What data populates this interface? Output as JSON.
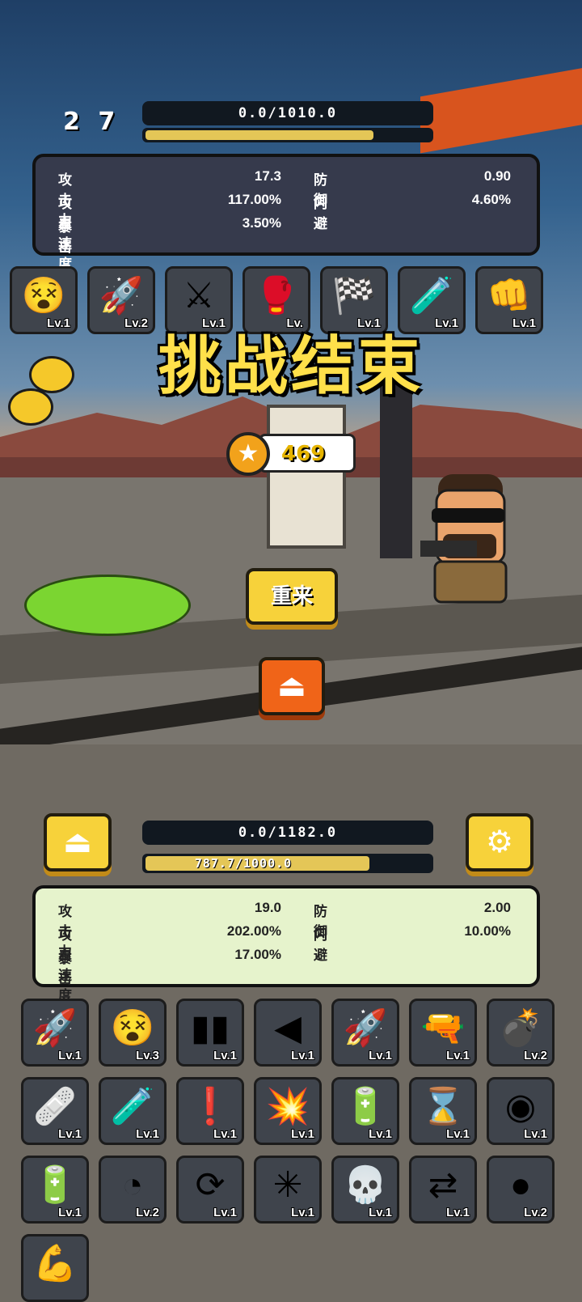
{
  "enemy": {
    "level": "2 7",
    "hp_text": "0.0/1010.0",
    "xp_progress": 0.8,
    "stats": {
      "atk_label": "攻击力",
      "atk_value": "17.3",
      "def_label": "防御",
      "def_value": "0.90",
      "aspd_label": "攻击速度",
      "aspd_value": "117.00%",
      "dodge_label": "闪避",
      "dodge_value": "4.60%",
      "crit_label": "暴击",
      "crit_value": "3.50%"
    },
    "skills": [
      {
        "icon": "dizzy-face-icon",
        "glyph": "😵",
        "level": "Lv.1"
      },
      {
        "icon": "rocket-icon",
        "glyph": "🚀",
        "level": "Lv.2"
      },
      {
        "icon": "crossed-swords-icon",
        "glyph": "⚔",
        "level": "Lv.1"
      },
      {
        "icon": "boxing-gloves-icon",
        "glyph": "🥊",
        "level": "Lv."
      },
      {
        "icon": "checkered-flag-icon",
        "glyph": "🏁",
        "level": "Lv.1"
      },
      {
        "icon": "potion-icon",
        "glyph": "🧪",
        "level": "Lv.1"
      },
      {
        "icon": "fist-icon",
        "glyph": "👊",
        "level": "Lv.1"
      }
    ]
  },
  "result": {
    "title": "挑战结束",
    "coins": "469",
    "retry_label": "重来"
  },
  "player": {
    "hp_text": "0.0/1182.0",
    "xp_text": "787.7/1000.0",
    "xp_progress": 0.7877,
    "stats": {
      "atk_label": "攻击力",
      "atk_value": "19.0",
      "def_label": "防御",
      "def_value": "2.00",
      "aspd_label": "攻击速度",
      "aspd_value": "202.00%",
      "dodge_label": "闪避",
      "dodge_value": "10.00%",
      "crit_label": "暴击",
      "crit_value": "17.00%"
    },
    "skills": [
      {
        "icon": "rocket-strike-icon",
        "glyph": "🚀",
        "level": "Lv.1"
      },
      {
        "icon": "dizzy-face-icon",
        "glyph": "😵",
        "level": "Lv.3"
      },
      {
        "icon": "bullets-icon",
        "glyph": "▮▮",
        "level": "Lv.1"
      },
      {
        "icon": "arrow-left-icon",
        "glyph": "◀",
        "level": "Lv.1"
      },
      {
        "icon": "missile-icon",
        "glyph": "🚀",
        "level": "Lv.1"
      },
      {
        "icon": "pistol-icon",
        "glyph": "🔫",
        "level": "Lv.1"
      },
      {
        "icon": "grenade-icon",
        "glyph": "💣",
        "level": "Lv.2"
      },
      {
        "icon": "medkit-icon",
        "glyph": "🩹",
        "level": "Lv.1"
      },
      {
        "icon": "potion-icon",
        "glyph": "🧪",
        "level": "Lv.1"
      },
      {
        "icon": "alert-gauge-icon",
        "glyph": "❗",
        "level": "Lv.1"
      },
      {
        "icon": "explosion-icon",
        "glyph": "💥",
        "level": "Lv.1"
      },
      {
        "icon": "battery-charge-icon",
        "glyph": "🔋",
        "level": "Lv.1"
      },
      {
        "icon": "hourglass-icon",
        "glyph": "⌛",
        "level": "Lv.1"
      },
      {
        "icon": "black-hole-icon",
        "glyph": "◉",
        "level": "Lv.1"
      },
      {
        "icon": "battery-icon",
        "glyph": "🔋",
        "level": "Lv.1"
      },
      {
        "icon": "speed-gauge-icon",
        "glyph": "◔",
        "level": "Lv.2"
      },
      {
        "icon": "refresh-bolt-icon",
        "glyph": "⟳",
        "level": "Lv.1"
      },
      {
        "icon": "network-icon",
        "glyph": "✳",
        "level": "Lv.1"
      },
      {
        "icon": "skull-icon",
        "glyph": "💀",
        "level": "Lv.1"
      },
      {
        "icon": "dash-arrows-icon",
        "glyph": "⇄",
        "level": "Lv.1"
      },
      {
        "icon": "bullet-icon",
        "glyph": "●",
        "level": "Lv.2"
      },
      {
        "icon": "muscle-icon",
        "glyph": "💪",
        "level": ""
      }
    ]
  },
  "buttons": {
    "exit_glyph": "⏏",
    "settings_glyph": "⚙",
    "coin_glyph": "★"
  },
  "colors": {
    "title_yellow": "#ffe04a",
    "button_yellow": "#f7d23a",
    "button_orange": "#f06418",
    "xp_fill": "#e4c657"
  }
}
